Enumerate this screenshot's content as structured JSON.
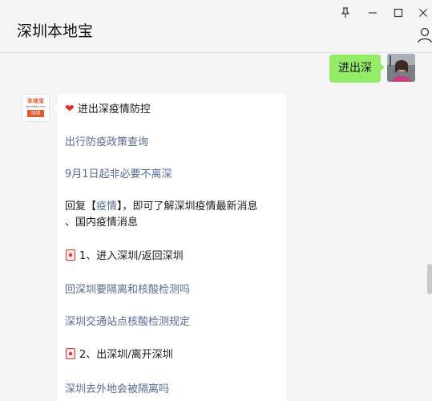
{
  "window": {
    "title": "深圳本地宝",
    "controls": {
      "pin": "⊥",
      "minimize": "—",
      "maximize": "□",
      "close": "✕"
    }
  },
  "chat": {
    "outgoing": {
      "text": "进出深"
    },
    "bot_avatar": {
      "logo_text": "本地宝",
      "logo_sub": "bendibao.com",
      "logo_city": "深圳"
    },
    "incoming": {
      "heading": "进出深疫情防控",
      "heart_icon": "❤",
      "link_1": "出行防疫政策查询",
      "link_2": "9月1日起非必要不离深",
      "reply_prefix": "回复【",
      "reply_keyword": "疫情",
      "reply_suffix": "】，即可了解深圳疫情最新消息",
      "reply_line2": "、国内疫情消息",
      "section_1": "1、进入深圳/返回深圳",
      "link_3": "回深圳要隔离和核酸检测吗",
      "link_4": "深圳交通站点核酸检测规定",
      "section_2": "2、出深圳/离开深圳",
      "link_5": "深圳去外地会被隔离吗"
    }
  }
}
